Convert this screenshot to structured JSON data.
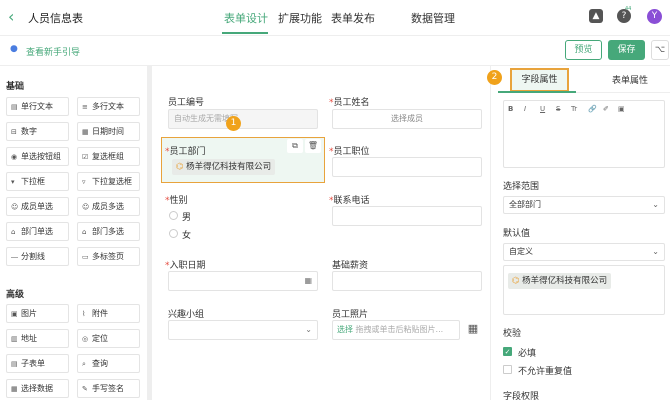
{
  "header": {
    "title": "人员信息表",
    "tabs": [
      "表单设计",
      "扩展功能",
      "表单发布",
      "数据管理"
    ],
    "avatar": "Y",
    "bell_badge": "",
    "help_badge": "44"
  },
  "subbar": {
    "guide": "查看新手引导",
    "preview": "预览",
    "save": "保存"
  },
  "palette": {
    "basic_title": "基础",
    "basic": [
      "单行文本",
      "多行文本",
      "数字",
      "日期时间",
      "单选按钮组",
      "复选框组",
      "下拉框",
      "下拉复选框",
      "成员单选",
      "成员多选",
      "部门单选",
      "部门多选",
      "分割线",
      "多标签页"
    ],
    "advanced_title": "高级",
    "advanced": [
      "图片",
      "附件",
      "地址",
      "定位",
      "子表单",
      "查询",
      "选择数据",
      "手写签名"
    ]
  },
  "form": {
    "emp_no_label": "员工编号",
    "emp_no_value": "自动生成无需填写",
    "emp_name_label": "员工姓名",
    "emp_name_btn": "选择成员",
    "dept_label": "员工部门",
    "dept_value": "杨羊得亿科技有限公司",
    "position_label": "员工职位",
    "gender_label": "性别",
    "male": "男",
    "female": "女",
    "phone_label": "联系电话",
    "hire_label": "入职日期",
    "salary_label": "基础薪资",
    "interest_label": "兴趣小组",
    "photo_label": "员工照片",
    "photo_select": "选择",
    "photo_hint": "拖拽或单击后粘贴图片..."
  },
  "badges": {
    "one": "1",
    "two": "2"
  },
  "props": {
    "tab_field": "字段属性",
    "tab_form": "表单属性",
    "editor_tools": [
      "B",
      "I",
      "U",
      "S",
      "Tr",
      "🔗",
      "✐",
      "▣"
    ],
    "scope_label": "选择范围",
    "scope_value": "全部部门",
    "default_label": "默认值",
    "default_mode": "自定义",
    "default_value": "杨羊得亿科技有限公司",
    "validate_label": "校验",
    "required": "必填",
    "no_dup": "不允许重复值",
    "perm_label": "字段权限"
  },
  "colors": {
    "accent": "#46a87a",
    "highlight": "#e8a33c",
    "required": "#e54d42"
  }
}
